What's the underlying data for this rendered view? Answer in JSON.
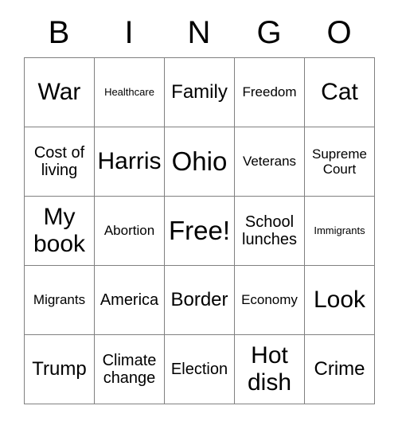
{
  "card": {
    "header": {
      "letters": [
        "B",
        "I",
        "N",
        "G",
        "O"
      ]
    },
    "rows": [
      [
        {
          "text": "War",
          "size": "fs-xxl"
        },
        {
          "text": "Healthcare",
          "size": "fs-xs"
        },
        {
          "text": "Family",
          "size": "fs-xl"
        },
        {
          "text": "Freedom",
          "size": "fs-m"
        },
        {
          "text": "Cat",
          "size": "fs-xxl"
        }
      ],
      [
        {
          "text": "Cost of living",
          "size": "fs-l"
        },
        {
          "text": "Harris",
          "size": "fs-xxl"
        },
        {
          "text": "Ohio",
          "size": "fs-max"
        },
        {
          "text": "Veterans",
          "size": "fs-m"
        },
        {
          "text": "Supreme Court",
          "size": "fs-m"
        }
      ],
      [
        {
          "text": "My book",
          "size": "fs-xxl"
        },
        {
          "text": "Abortion",
          "size": "fs-m"
        },
        {
          "text": "Free!",
          "size": "fs-max"
        },
        {
          "text": "School lunches",
          "size": "fs-l"
        },
        {
          "text": "Immigrants",
          "size": "fs-xs"
        }
      ],
      [
        {
          "text": "Migrants",
          "size": "fs-m"
        },
        {
          "text": "America",
          "size": "fs-l"
        },
        {
          "text": "Border",
          "size": "fs-xl"
        },
        {
          "text": "Economy",
          "size": "fs-m"
        },
        {
          "text": "Look",
          "size": "fs-xxl"
        }
      ],
      [
        {
          "text": "Trump",
          "size": "fs-xl"
        },
        {
          "text": "Climate change",
          "size": "fs-l"
        },
        {
          "text": "Election",
          "size": "fs-l"
        },
        {
          "text": "Hot dish",
          "size": "fs-xxl"
        },
        {
          "text": "Crime",
          "size": "fs-xl"
        }
      ]
    ]
  },
  "colors": {
    "background": "#ffffff",
    "text": "#000000",
    "grid_line": "#808080"
  }
}
